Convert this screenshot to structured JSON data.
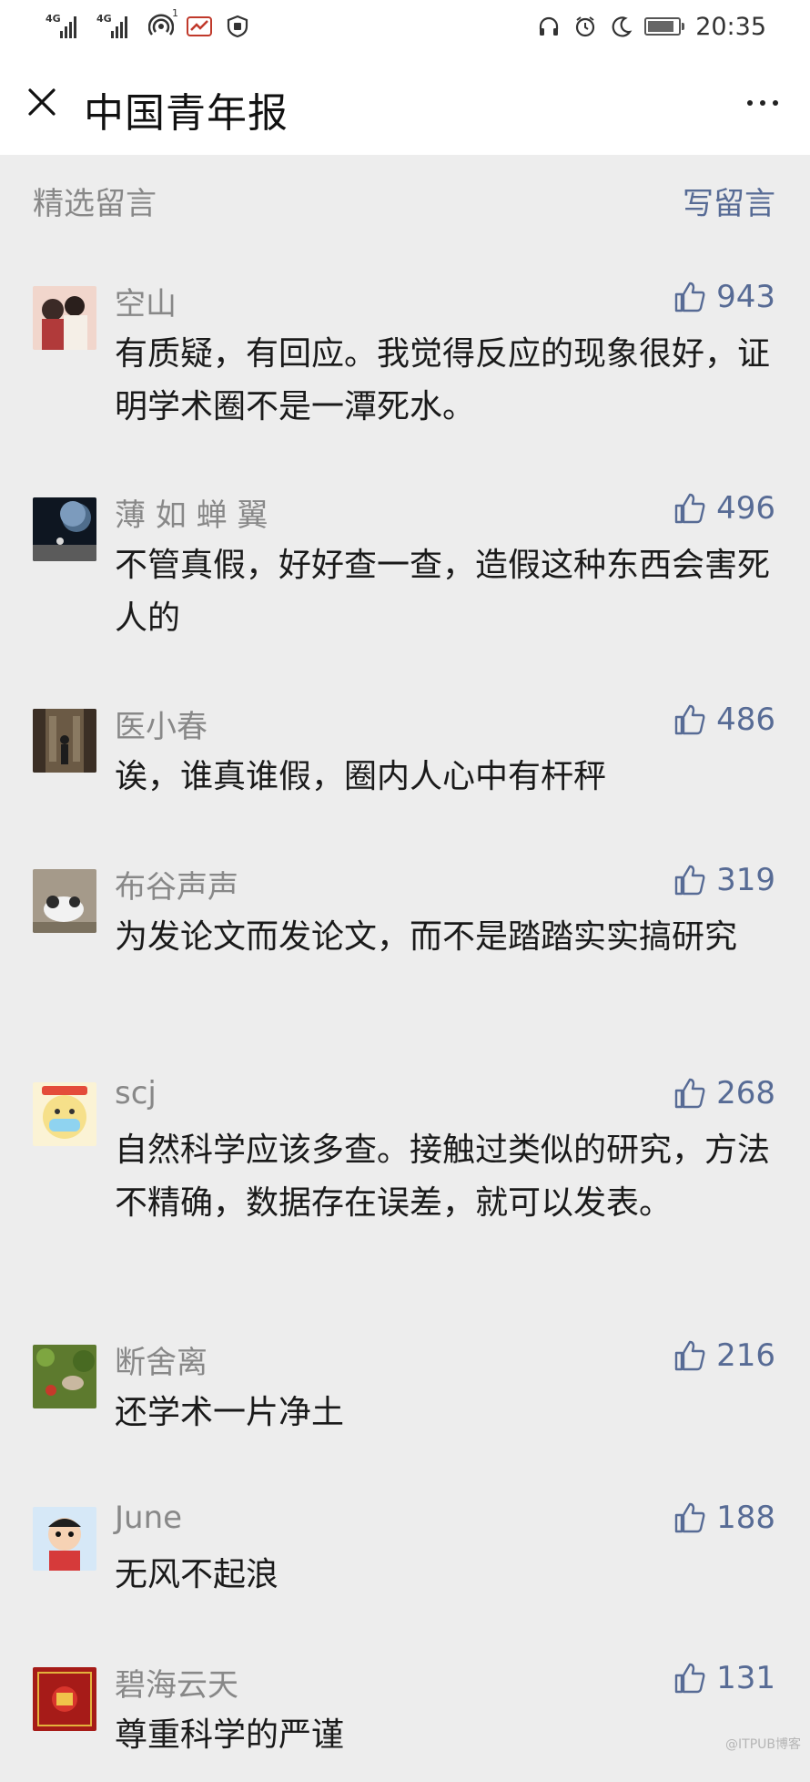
{
  "status_bar": {
    "network_1": "4G",
    "network_2": "4G",
    "hotspot_badge": "1",
    "time": "20:35"
  },
  "header": {
    "title": "中国青年报"
  },
  "section": {
    "title": "精选留言",
    "write_label": "写留言"
  },
  "comments": [
    {
      "nickname": "空山",
      "likes": "943",
      "content": "有质疑，有回应。我觉得反应的现象很好，证明学术圈不是一潭死水。",
      "avatar_color": "#e9c9c0"
    },
    {
      "nickname": "薄 如 蝉 翼",
      "likes": "496",
      "content": "不管真假，好好查一查，造假这种东西会害死人的",
      "avatar_color": "#1d2a3a"
    },
    {
      "nickname": "医小春",
      "likes": "486",
      "content": "诶，谁真谁假，圈内人心中有杆秤",
      "avatar_color": "#5a4a3a"
    },
    {
      "nickname": "布谷声声",
      "likes": "319",
      "content": "为发论文而发论文，而不是踏踏实实搞研究",
      "avatar_color": "#9a8f7e"
    },
    {
      "nickname": "scj",
      "likes": "268",
      "content": "自然科学应该多查。接触过类似的研究，方法不精确，数据存在误差，就可以发表。",
      "avatar_color": "#f3d64a"
    },
    {
      "nickname": "断舍离",
      "likes": "216",
      "content": "还学术一片净土",
      "avatar_color": "#6f8a3c"
    },
    {
      "nickname": "June",
      "likes": "188",
      "content": "无风不起浪",
      "avatar_color": "#cfe3f5"
    },
    {
      "nickname": "碧海云天",
      "likes": "131",
      "content": "尊重科学的严谨",
      "avatar_color": "#b0201c"
    }
  ],
  "watermark": "@ITPUB博客",
  "colors": {
    "link": "#576b95",
    "meta": "#888888",
    "background": "#ededed"
  }
}
